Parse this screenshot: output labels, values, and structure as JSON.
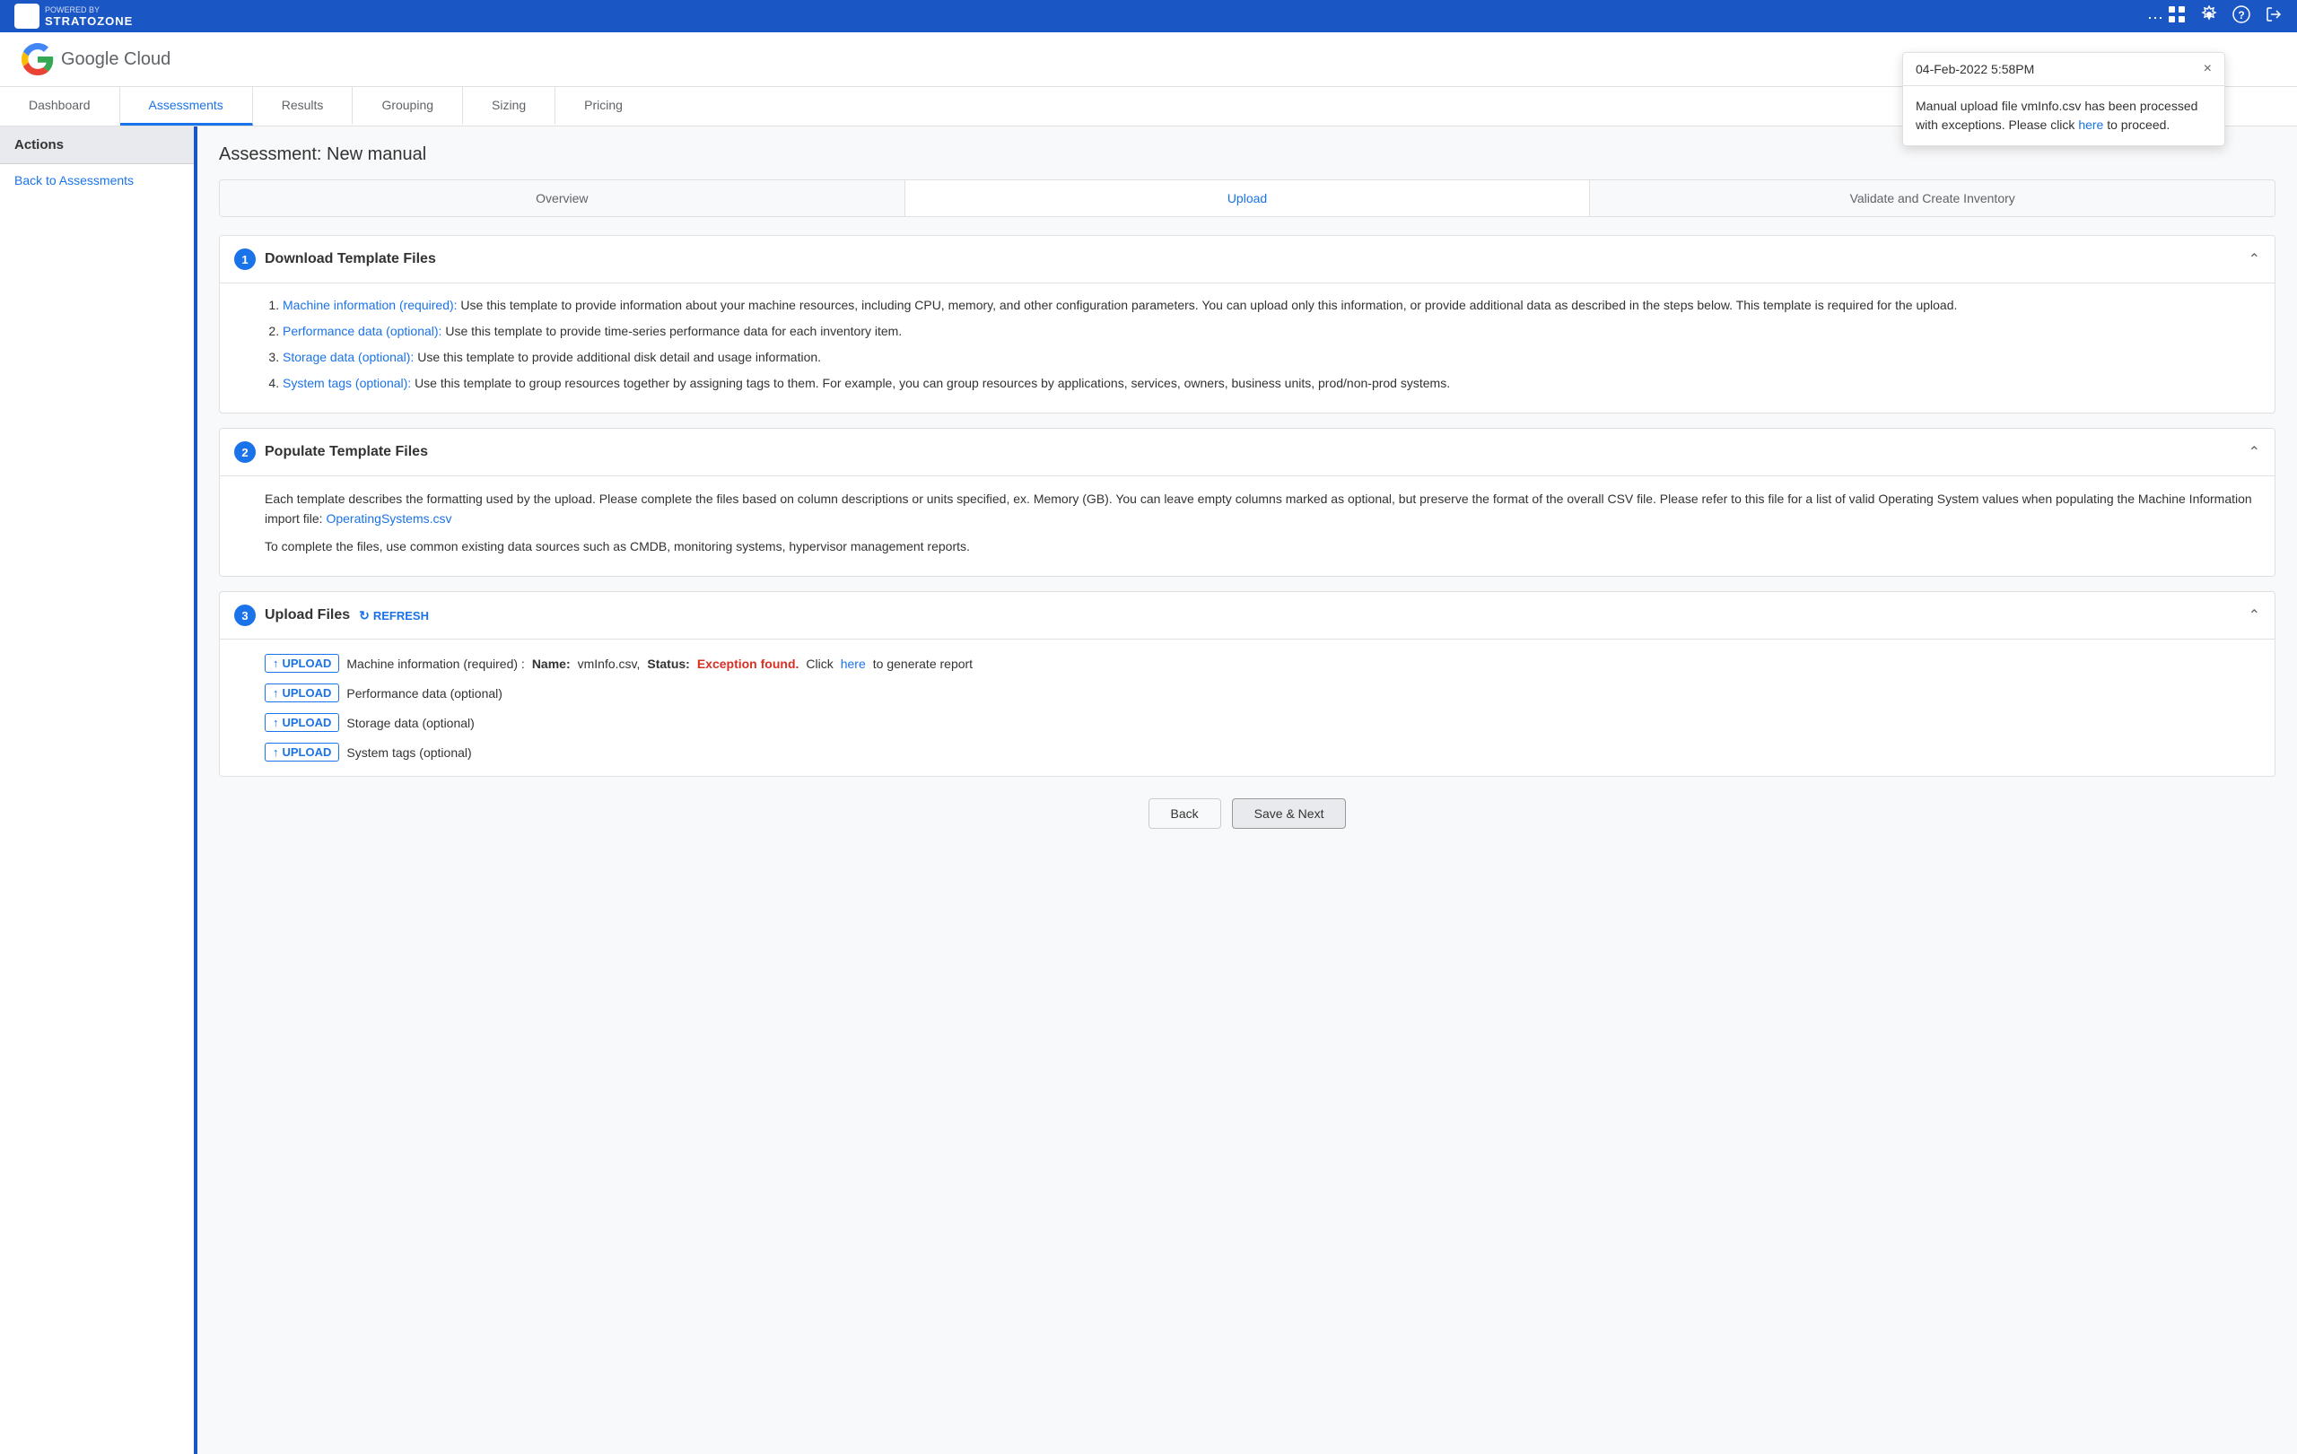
{
  "topbar": {
    "brand": "POWERED BY",
    "product": "STRATOZONE",
    "icons": [
      "grid-icon",
      "settings-icon",
      "help-icon",
      "logout-icon"
    ]
  },
  "header": {
    "logo_text": "Google Cloud"
  },
  "nav": {
    "tabs": [
      {
        "id": "dashboard",
        "label": "Dashboard",
        "active": false
      },
      {
        "id": "assessments",
        "label": "Assessments",
        "active": true
      },
      {
        "id": "results",
        "label": "Results",
        "active": false
      },
      {
        "id": "grouping",
        "label": "Grouping",
        "active": false
      },
      {
        "id": "sizing",
        "label": "Sizing",
        "active": false
      },
      {
        "id": "pricing",
        "label": "Pricing",
        "active": false
      }
    ]
  },
  "sidebar": {
    "header": "Actions",
    "items": [
      {
        "id": "back-to-assessments",
        "label": "Back to Assessments"
      }
    ]
  },
  "assessment": {
    "title": "Assessment: New manual"
  },
  "sub_tabs": [
    {
      "id": "overview",
      "label": "Overview",
      "active": false
    },
    {
      "id": "upload",
      "label": "Upload",
      "active": true
    },
    {
      "id": "validate",
      "label": "Validate and Create Inventory",
      "active": false
    }
  ],
  "sections": {
    "download": {
      "number": "1",
      "title": "Download Template Files",
      "items": [
        {
          "link_text": "Machine information (required):",
          "description": "Use this template to provide information about your machine resources, including CPU, memory, and other configuration parameters. You can upload only this information, or provide additional data as described in the steps below. This template is required for the upload."
        },
        {
          "link_text": "Performance data (optional):",
          "description": "Use this template to provide time-series performance data for each inventory item."
        },
        {
          "link_text": "Storage data (optional):",
          "description": "Use this template to provide additional disk detail and usage information."
        },
        {
          "link_text": "System tags (optional):",
          "description": "Use this template to group resources together by assigning tags to them. For example, you can group resources by applications, services, owners, business units, prod/non-prod systems."
        }
      ]
    },
    "populate": {
      "number": "2",
      "title": "Populate Template Files",
      "paragraph1": "Each template describes the formatting used by the upload. Please complete the files based on column descriptions or units specified, ex. Memory (GB). You can leave empty columns marked as optional, but preserve the format of the overall CSV file. Please refer to this file for a list of valid Operating System values when populating the Machine Information import file:",
      "os_link": "OperatingSystems.csv",
      "paragraph2": "To complete the files, use common existing data sources such as CMDB, monitoring systems, hypervisor management reports."
    },
    "upload": {
      "number": "3",
      "title": "Upload Files",
      "refresh_label": "REFRESH",
      "rows": [
        {
          "id": "machine-info",
          "button_label": "UPLOAD",
          "description": "Machine information (required) :",
          "name_label": "Name:",
          "name_value": "vmInfo.csv,",
          "status_label": "Status:",
          "status_value": "Exception found.",
          "action_text": "Click",
          "action_link": "here",
          "action_suffix": "to generate report"
        },
        {
          "id": "performance",
          "button_label": "UPLOAD",
          "description": "Performance data (optional)"
        },
        {
          "id": "storage",
          "button_label": "UPLOAD",
          "description": "Storage data (optional)"
        },
        {
          "id": "system-tags",
          "button_label": "UPLOAD",
          "description": "System tags (optional)"
        }
      ]
    }
  },
  "footer": {
    "back_label": "Back",
    "save_next_label": "Save & Next"
  },
  "notification": {
    "timestamp": "04-Feb-2022 5:58PM",
    "message_prefix": "Manual upload file vmInfo.csv has been processed with exceptions. Please click ",
    "link_text": "here",
    "message_suffix": " to proceed.",
    "close_label": "×"
  }
}
